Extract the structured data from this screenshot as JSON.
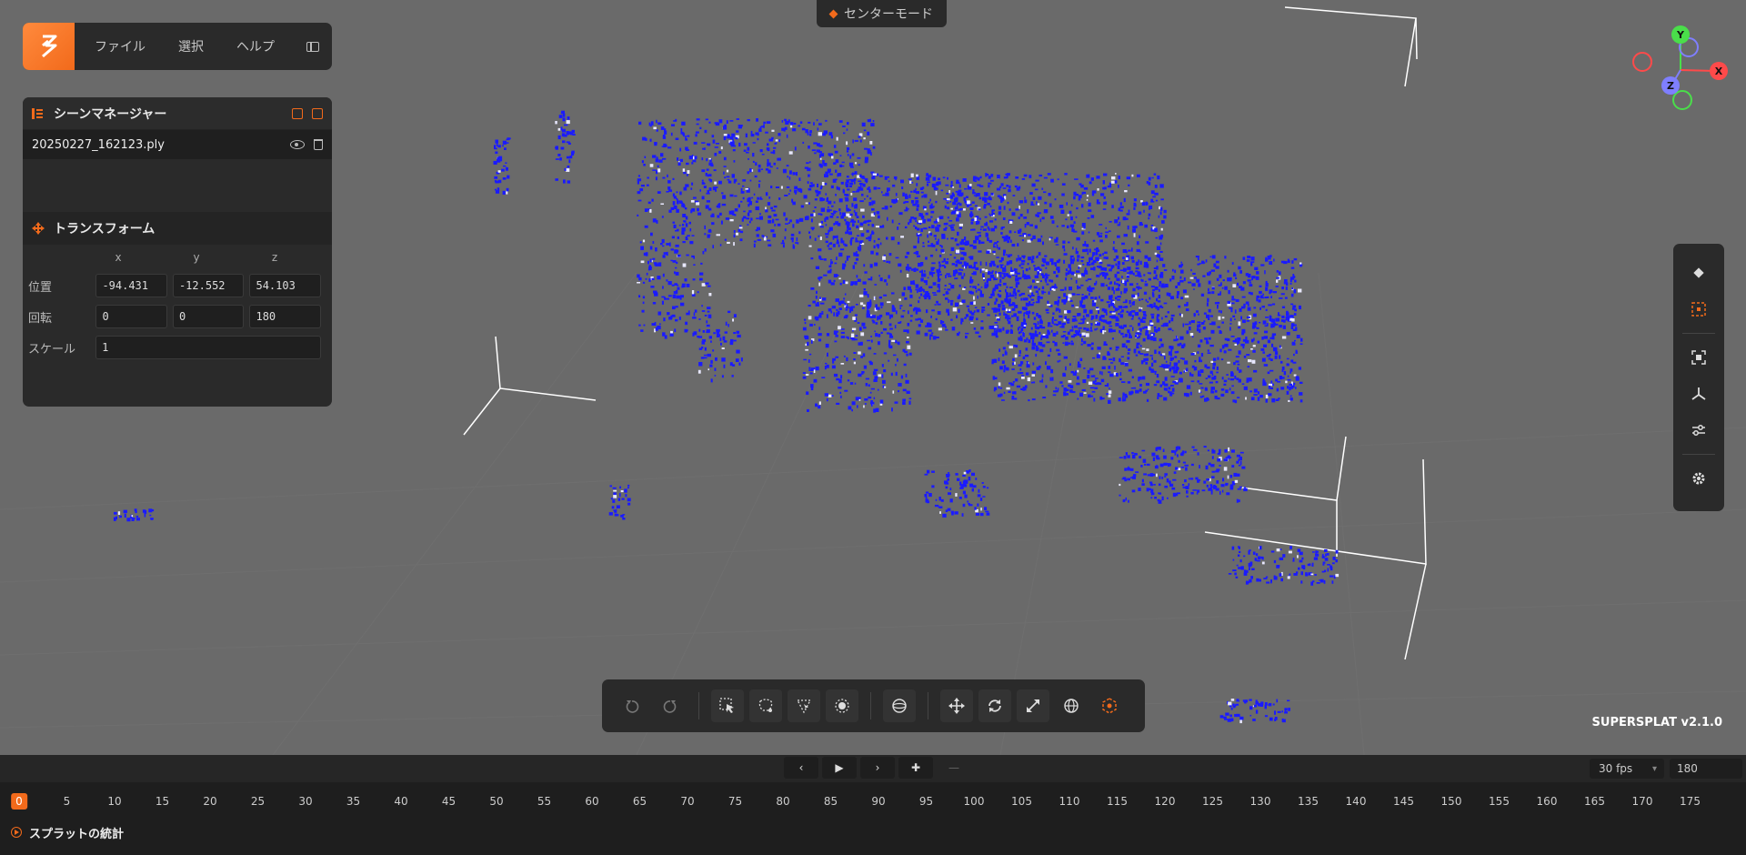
{
  "menu": {
    "items": [
      "ファイル",
      "選択",
      "ヘルプ"
    ]
  },
  "center_mode": {
    "label": "センターモード"
  },
  "scene_manager": {
    "title": "シーンマネージャー",
    "file_name": "20250227_162123.ply"
  },
  "transform": {
    "title": "トランスフォーム",
    "axes": [
      "x",
      "y",
      "z"
    ],
    "position_label": "位置",
    "rotation_label": "回転",
    "scale_label": "スケール",
    "position": [
      "-94.431",
      "-12.552",
      "54.103"
    ],
    "rotation": [
      "0",
      "0",
      "180"
    ],
    "scale": "1"
  },
  "gizmo": {
    "y": "Y",
    "x": "X",
    "z": "Z"
  },
  "version": "SUPERSPLAT v2.1.0",
  "timeline": {
    "fps": "30 fps",
    "frames": "180",
    "current": "0",
    "ticks": [
      "0",
      "5",
      "10",
      "15",
      "20",
      "25",
      "30",
      "35",
      "40",
      "45",
      "50",
      "55",
      "60",
      "65",
      "70",
      "75",
      "80",
      "85",
      "90",
      "95",
      "100",
      "105",
      "110",
      "115",
      "120",
      "125",
      "130",
      "135",
      "140",
      "145",
      "150",
      "155",
      "160",
      "165",
      "170",
      "175"
    ]
  },
  "stats": {
    "label": "スプラットの統計"
  },
  "colors": {
    "accent": "#f26a1b",
    "splat": "#1a1aff",
    "panel": "#2a2a2a",
    "viewport": "#6a6a6a"
  }
}
